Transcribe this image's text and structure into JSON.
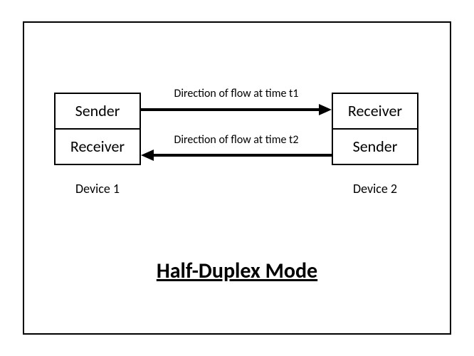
{
  "title": "Half-Duplex Mode",
  "devices": {
    "left": {
      "top_role": "Sender",
      "bottom_role": "Receiver",
      "label": "Device 1"
    },
    "right": {
      "top_role": "Receiver",
      "bottom_role": "Sender",
      "label": "Device 2"
    }
  },
  "flows": {
    "top": {
      "label": "Direction of flow at time t1",
      "direction": "right"
    },
    "bottom": {
      "label": "Direction of flow at time t2",
      "direction": "left"
    }
  }
}
